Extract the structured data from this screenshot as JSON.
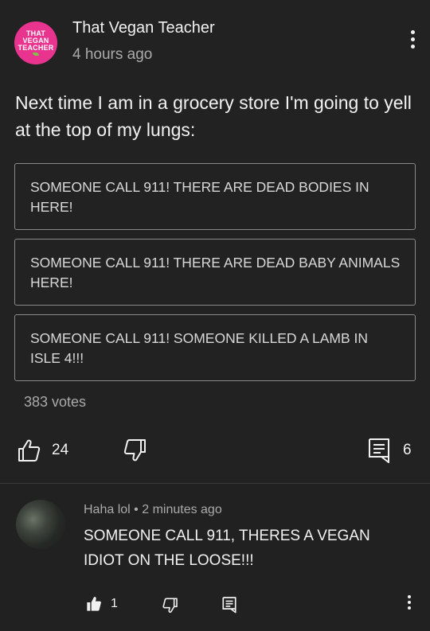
{
  "post": {
    "avatar_text": [
      "THAT",
      "VEGAN",
      "TEACHER"
    ],
    "channel_name": "That Vegan Teacher",
    "timestamp": "4 hours ago",
    "text": "Next time I am in a grocery store I'm going to yell at the top of my lungs:",
    "poll_options": [
      "SOMEONE CALL 911! THERE ARE DEAD BODIES IN HERE!",
      "SOMEONE CALL 911! THERE ARE DEAD BABY ANIMALS HERE!",
      "SOMEONE CALL 911!  SOMEONE KILLED A LAMB IN ISLE 4!!!"
    ],
    "votes": "383 votes",
    "likes": "24",
    "comments": "6",
    "icons": {
      "like": "thumbs-up-icon",
      "dislike": "thumbs-down-icon",
      "comment": "comment-icon",
      "menu": "more-vert-icon"
    }
  },
  "comment": {
    "author": "Haha lol",
    "separator": "•",
    "timestamp": "2 minutes ago",
    "text": "SOMEONE CALL 911, THERES A VEGAN IDIOT ON THE LOOSE!!!",
    "likes": "1",
    "icons": {
      "like": "thumbs-up-filled-icon",
      "dislike": "thumbs-down-icon",
      "reply": "comment-icon",
      "menu": "more-vert-icon"
    }
  },
  "colors": {
    "background": "#222222",
    "text": "#f1f1f1",
    "secondary_text": "#aaaaaa",
    "poll_border": "#8a8a8a",
    "avatar_pink": "#e8348f"
  }
}
